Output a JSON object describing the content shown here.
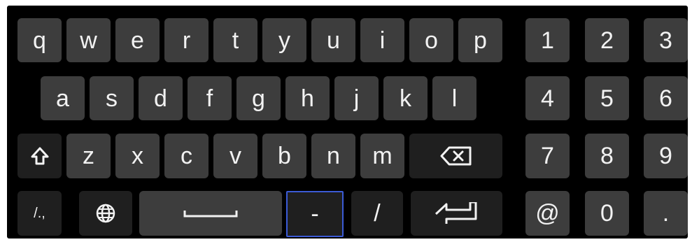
{
  "keyboard": {
    "row1": [
      "q",
      "w",
      "e",
      "r",
      "t",
      "y",
      "u",
      "i",
      "o",
      "p"
    ],
    "row2": [
      "a",
      "s",
      "d",
      "f",
      "g",
      "h",
      "j",
      "k",
      "l"
    ],
    "row3": [
      "z",
      "x",
      "c",
      "v",
      "b",
      "n",
      "m"
    ],
    "row4": {
      "symbols_label": "/.,",
      "dash_label": "-",
      "slash_label": "/"
    },
    "numpad": [
      "1",
      "2",
      "3",
      "4",
      "5",
      "6",
      "7",
      "8",
      "9",
      "@",
      "0",
      "."
    ],
    "icons": {
      "shift": "shift-icon",
      "backspace": "backspace-icon",
      "globe": "globe-icon",
      "space": "space-icon",
      "enter": "enter-icon"
    },
    "focused_key": "-",
    "colors": {
      "key": "#3d3d3d",
      "dark_key": "#1f1f1f",
      "focus": "#3b5bd6",
      "background": "#000000"
    }
  }
}
